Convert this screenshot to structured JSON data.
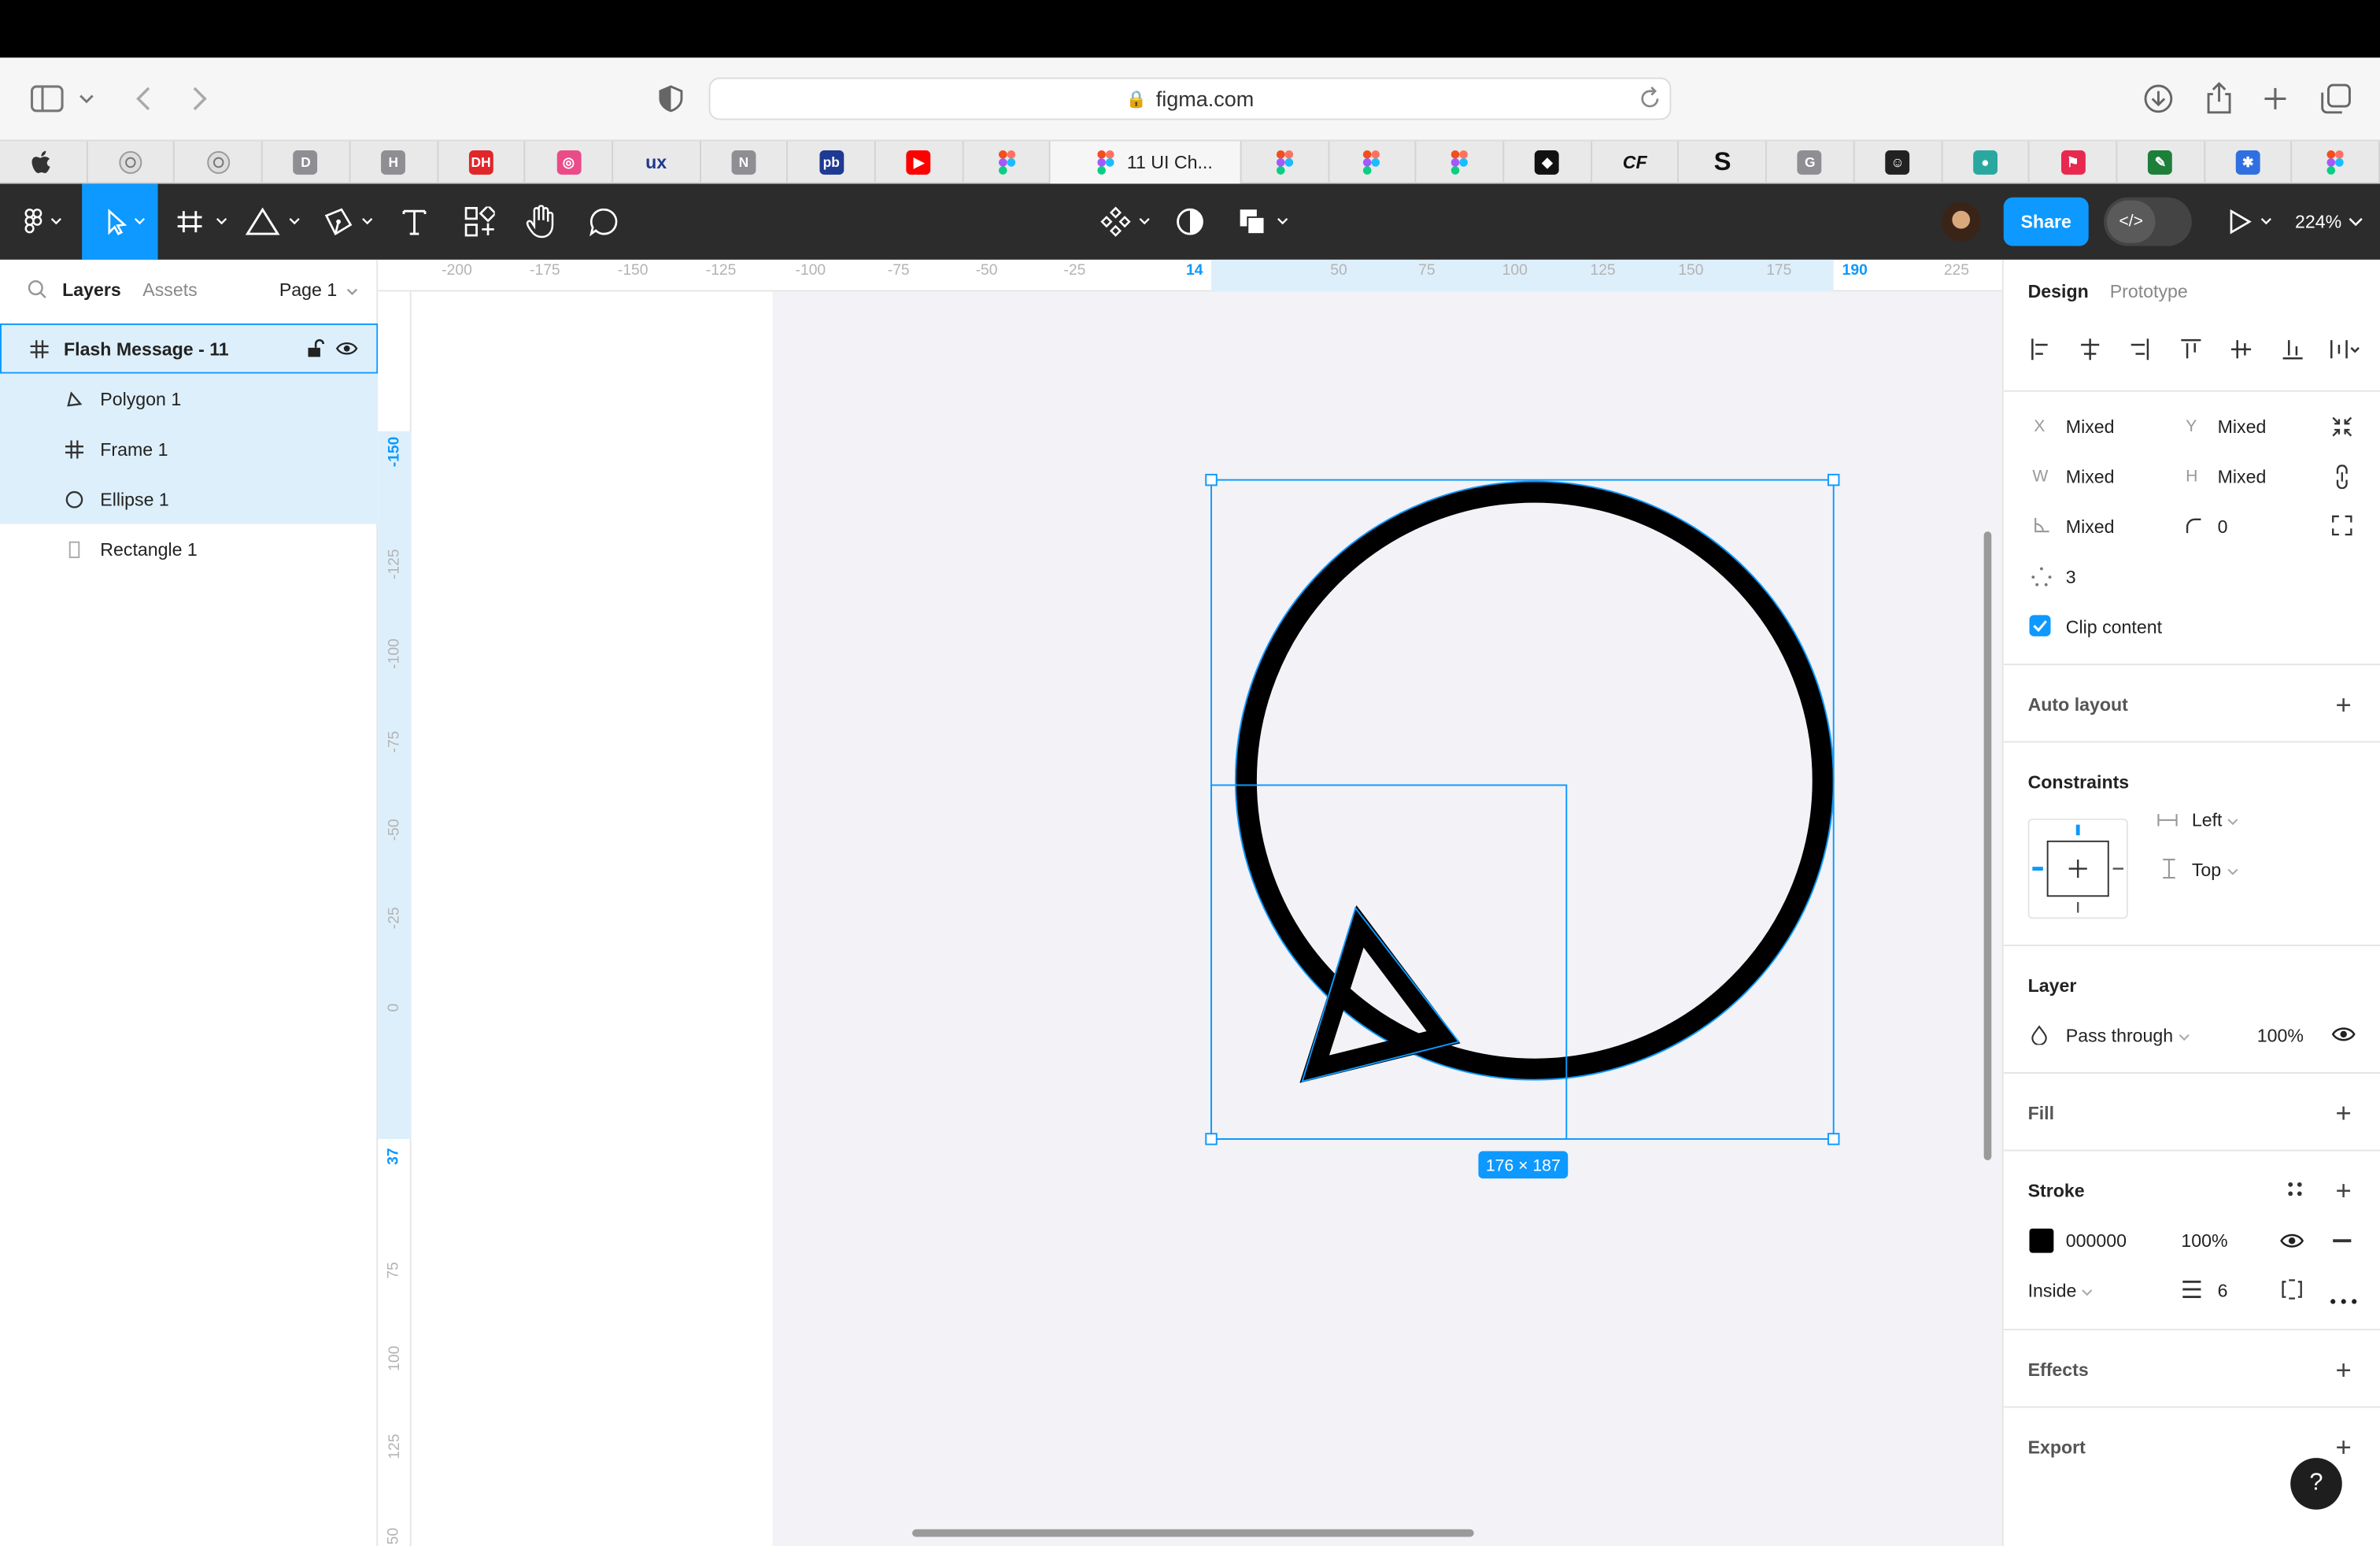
{
  "browser": {
    "url": "figma.com",
    "tabs": [
      {
        "icon": "apple-icon"
      },
      {
        "icon": "site-icon"
      },
      {
        "icon": "site-icon"
      },
      {
        "icon": "d-icon",
        "glyph": "D",
        "color": "#8e8e93"
      },
      {
        "icon": "h-icon",
        "glyph": "H",
        "color": "#8e8e93"
      },
      {
        "icon": "dh-icon",
        "glyph": "DH",
        "color": "#e0262a"
      },
      {
        "icon": "dribbble-icon",
        "glyph": "◎",
        "color": "#ea4c89"
      },
      {
        "icon": "ux-icon",
        "glyph": "ux",
        "color": "#1e3a8a"
      },
      {
        "icon": "n-icon",
        "glyph": "N",
        "color": "#8e8e93"
      },
      {
        "icon": "pb-icon",
        "glyph": "pb",
        "color": "#1f3a93"
      },
      {
        "icon": "youtube-icon",
        "glyph": "▶",
        "color": "#ff0000"
      },
      {
        "icon": "figma-icon",
        "glyph": "F",
        "color": "#f24e1e"
      },
      {
        "icon": "figma-icon",
        "label": "11 UI Ch...",
        "active": true
      },
      {
        "icon": "figma-icon",
        "glyph": "F",
        "color": "#f24e1e"
      },
      {
        "icon": "figma-icon",
        "glyph": "F",
        "color": "#f24e1e"
      },
      {
        "icon": "figma-icon",
        "glyph": "F",
        "color": "#f24e1e"
      },
      {
        "icon": "mosaic-icon",
        "glyph": "◆",
        "color": "#111"
      },
      {
        "icon": "cf-icon",
        "glyph": "CF",
        "color": "#111"
      },
      {
        "icon": "s-icon",
        "glyph": "S",
        "color": "#111"
      },
      {
        "icon": "g-icon",
        "glyph": "G",
        "color": "#8e8e93"
      },
      {
        "icon": "mailchimp-icon",
        "glyph": "☺",
        "color": "#222"
      },
      {
        "icon": "globe-icon",
        "glyph": "●",
        "color": "#2aa8a0"
      },
      {
        "icon": "flag-icon",
        "glyph": "⚑",
        "color": "#e8284f"
      },
      {
        "icon": "pen-icon",
        "glyph": "✎",
        "color": "#1e7f3a"
      },
      {
        "icon": "asterisk-icon",
        "glyph": "✱",
        "color": "#2f6fe0"
      },
      {
        "icon": "figma-icon",
        "glyph": "F",
        "color": "#f24e1e"
      }
    ]
  },
  "toolbar": {
    "share_label": "Share",
    "zoom": "224%",
    "dev_mode_glyph": "</>"
  },
  "left_panel": {
    "tab_layers": "Layers",
    "tab_assets": "Assets",
    "page": "Page 1",
    "layers": [
      {
        "name": "Flash Message - 11",
        "type": "frame",
        "depth": 0,
        "selected": true
      },
      {
        "name": "Polygon 1",
        "type": "polygon",
        "depth": 1,
        "highlight": true
      },
      {
        "name": "Frame 1",
        "type": "frame",
        "depth": 1,
        "highlight": true
      },
      {
        "name": "Ellipse 1",
        "type": "ellipse",
        "depth": 1,
        "highlight": true
      },
      {
        "name": "Rectangle 1",
        "type": "rectangle",
        "depth": 1,
        "highlight": false
      }
    ]
  },
  "rulers": {
    "top": [
      "-200",
      "-175",
      "-150",
      "-125",
      "-100",
      "-75",
      "-50",
      "-25",
      "14",
      "50",
      "75",
      "100",
      "125",
      "150",
      "175",
      "190",
      "225"
    ],
    "left": [
      "-150",
      "-125",
      "-100",
      "-75",
      "-50",
      "-25",
      "0",
      "37",
      "75",
      "100",
      "125",
      "50"
    ]
  },
  "canvas": {
    "size_label": "176 × 187",
    "accent": "#0d99ff",
    "stroke_color": "#000000"
  },
  "right_panel": {
    "tab_design": "Design",
    "tab_prototype": "Prototype",
    "x_label": "X",
    "x_value": "Mixed",
    "y_label": "Y",
    "y_value": "Mixed",
    "w_label": "W",
    "w_value": "Mixed",
    "h_label": "H",
    "h_value": "Mixed",
    "rotation_value": "Mixed",
    "radius_value": "0",
    "corner_count": "3",
    "clip_content": "Clip content",
    "auto_layout": "Auto layout",
    "constraints": "Constraints",
    "constraint_h": "Left",
    "constraint_v": "Top",
    "layer": "Layer",
    "blend": "Pass through",
    "opacity": "100%",
    "fill": "Fill",
    "stroke": "Stroke",
    "stroke_hex": "000000",
    "stroke_opacity": "100%",
    "stroke_position": "Inside",
    "stroke_weight": "6",
    "effects": "Effects",
    "export": "Export",
    "help": "?"
  }
}
